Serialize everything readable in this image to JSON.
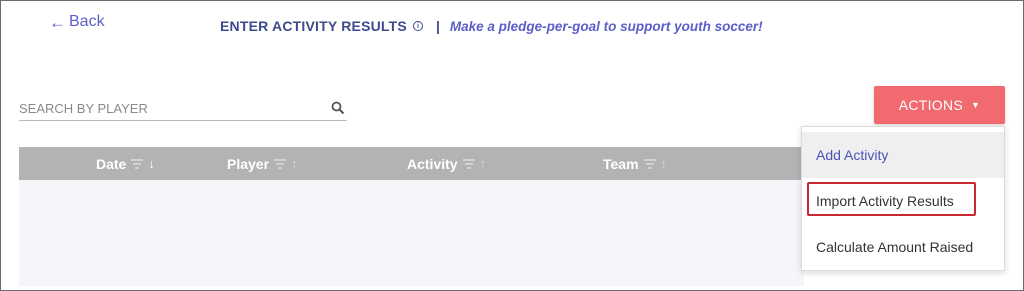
{
  "nav": {
    "back_label": "Back",
    "back_icon": "arrow-left-icon"
  },
  "header": {
    "title": "ENTER ACTIVITY RESULTS",
    "info_icon": "info-icon",
    "separator": "|",
    "promo": "Make a pledge-per-goal to support youth soccer!"
  },
  "search": {
    "placeholder": "SEARCH BY PLAYER",
    "value": "",
    "icon": "search-icon"
  },
  "actions": {
    "label": "ACTIONS",
    "color": "#f06a6f",
    "menu": [
      {
        "label": "Add Activity",
        "hovered": true
      },
      {
        "label": "Import Activity Results",
        "highlighted": true
      },
      {
        "label": "Calculate Amount Raised"
      }
    ]
  },
  "table": {
    "header_color": "#b3b3b3",
    "columns": [
      {
        "label": "Date",
        "sort": "descending"
      },
      {
        "label": "Player",
        "sort": "none"
      },
      {
        "label": "Activity",
        "sort": "none"
      },
      {
        "label": "Team",
        "sort": "none"
      }
    ]
  },
  "colors": {
    "accent": "#5b5fc7",
    "title": "#3d4a8c",
    "highlight_border": "#c8282f"
  }
}
